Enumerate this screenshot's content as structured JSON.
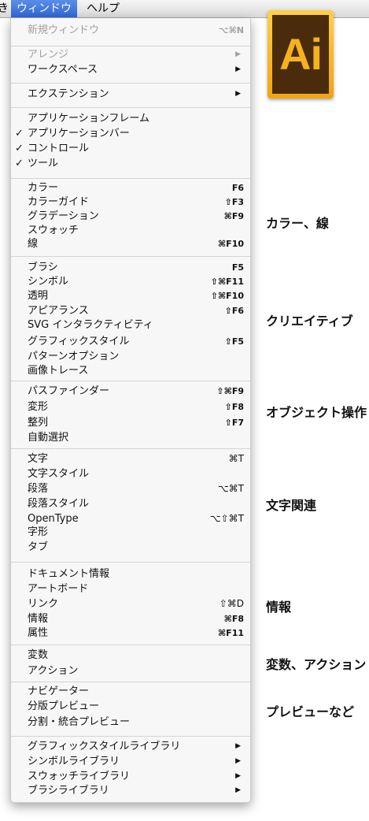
{
  "menubar": {
    "left_partial": "き",
    "window": "ウィンドウ",
    "help": "ヘルプ"
  },
  "menu": {
    "items": [
      {
        "label": "新規ウィンドウ",
        "shortcut": "⌥⌘N",
        "disabled": true
      },
      {
        "label": "アレンジ",
        "submenu": true,
        "disabled": true
      },
      {
        "label": "ワークスペース",
        "submenu": true
      },
      {
        "label": "エクステンション",
        "submenu": true
      },
      {
        "label": "アプリケーションフレーム"
      },
      {
        "label": "アプリケーションバー",
        "checked": true
      },
      {
        "label": "コントロール",
        "checked": true
      },
      {
        "label": "ツール",
        "checked": true
      },
      {
        "label": "カラー",
        "shortcut": "F6"
      },
      {
        "label": "カラーガイド",
        "shortcut": "⇧F3"
      },
      {
        "label": "グラデーション",
        "shortcut": "⌘F9"
      },
      {
        "label": "スウォッチ"
      },
      {
        "label": "線",
        "shortcut": "⌘F10"
      },
      {
        "label": "ブラシ",
        "shortcut": "F5"
      },
      {
        "label": "シンボル",
        "shortcut": "⇧⌘F11"
      },
      {
        "label": "透明",
        "shortcut": "⇧⌘F10"
      },
      {
        "label": "アピアランス",
        "shortcut": "⇧F6"
      },
      {
        "label": "SVG インタラクティビティ"
      },
      {
        "label": "グラフィックスタイル",
        "shortcut": "⇧F5"
      },
      {
        "label": "パターンオプション"
      },
      {
        "label": "画像トレース"
      },
      {
        "label": "パスファインダー",
        "shortcut": "⇧⌘F9"
      },
      {
        "label": "変形",
        "shortcut": "⇧F8"
      },
      {
        "label": "整列",
        "shortcut": "⇧F7"
      },
      {
        "label": "自動選択"
      },
      {
        "label": "文字",
        "shortcut": "⌘T",
        "wide": true
      },
      {
        "label": "文字スタイル"
      },
      {
        "label": "段落",
        "shortcut": "⌥⌘T",
        "wide": true
      },
      {
        "label": "段落スタイル"
      },
      {
        "label": "OpenType",
        "shortcut": "⌥⇧⌘T",
        "wide": true
      },
      {
        "label": "字形"
      },
      {
        "label": "タブ"
      },
      {
        "label": "ドキュメント情報"
      },
      {
        "label": "アートボード"
      },
      {
        "label": "リンク",
        "shortcut": "⇧⌘D",
        "wide": true
      },
      {
        "label": "情報",
        "shortcut": "⌘F8"
      },
      {
        "label": "属性",
        "shortcut": "⌘F11"
      },
      {
        "label": "変数"
      },
      {
        "label": "アクション"
      },
      {
        "label": "ナビゲーター"
      },
      {
        "label": "分版プレビュー"
      },
      {
        "label": "分割・統合プレビュー"
      },
      {
        "label": "グラフィックスタイルライブラリ",
        "submenu": true
      },
      {
        "label": "シンボルライブラリ",
        "submenu": true
      },
      {
        "label": "スウォッチライブラリ",
        "submenu": true
      },
      {
        "label": "ブラシライブラリ",
        "submenu": true
      }
    ]
  },
  "logo": {
    "text": "Ai"
  },
  "categories": [
    "カラー、線",
    "クリエイティブ",
    "オブジェクト操作",
    "文字関連",
    "情報",
    "変数、アクション",
    "プレビューなど"
  ],
  "colors": {
    "menubar_active": "#2f67d3",
    "logo_frame": "#f0a410",
    "logo_bg": "#4a2c0c",
    "logo_text": "#f5b21f"
  }
}
